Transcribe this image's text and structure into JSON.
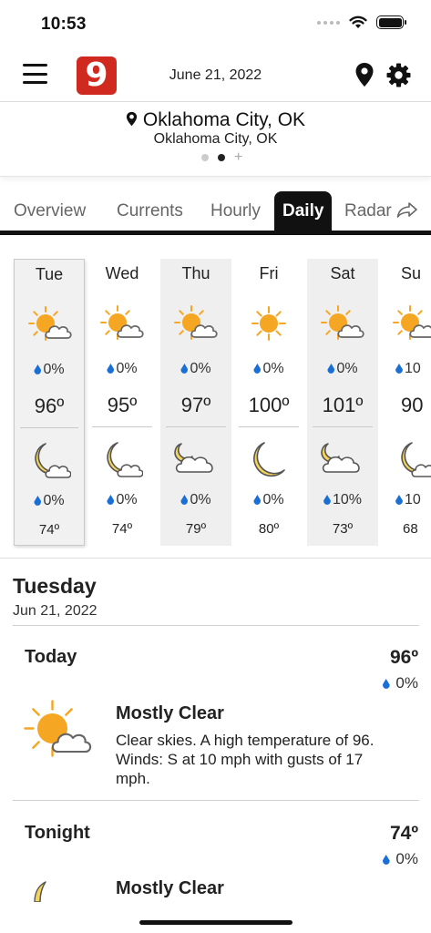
{
  "status_bar": {
    "time": "10:53"
  },
  "header": {
    "logo_text": "9",
    "date": "June 21, 2022"
  },
  "location": {
    "primary": "Oklahoma City, OK",
    "secondary": "Oklahoma City, OK"
  },
  "tabs": [
    {
      "label": "Overview",
      "active": false
    },
    {
      "label": "Currents",
      "active": false
    },
    {
      "label": "Hourly",
      "active": false
    },
    {
      "label": "Daily",
      "active": true
    },
    {
      "label": "Radar",
      "active": false
    }
  ],
  "daily": [
    {
      "day": "Tue",
      "day_icon": "partly-sunny-icon",
      "day_precip": "0%",
      "high": "96º",
      "night_icon": "moon-cloud-icon",
      "night_precip": "0%",
      "low": "74º"
    },
    {
      "day": "Wed",
      "day_icon": "partly-sunny-icon",
      "day_precip": "0%",
      "high": "95º",
      "night_icon": "moon-cloud-icon",
      "night_precip": "0%",
      "low": "74º"
    },
    {
      "day": "Thu",
      "day_icon": "partly-sunny-icon",
      "day_precip": "0%",
      "high": "97º",
      "night_icon": "cloud-moon-icon",
      "night_precip": "0%",
      "low": "79º"
    },
    {
      "day": "Fri",
      "day_icon": "sun-icon",
      "day_precip": "0%",
      "high": "100º",
      "night_icon": "moon-icon",
      "night_precip": "0%",
      "low": "80º"
    },
    {
      "day": "Sat",
      "day_icon": "partly-sunny-icon",
      "day_precip": "0%",
      "high": "101º",
      "night_icon": "cloud-moon-icon",
      "night_precip": "10%",
      "low": "73º"
    },
    {
      "day": "Su",
      "day_icon": "partly-sunny-icon",
      "day_precip": "10",
      "high": "90",
      "night_icon": "moon-cloud-icon",
      "night_precip": "10",
      "low": "68"
    }
  ],
  "detail": {
    "title": "Tuesday",
    "date": "Jun 21, 2022",
    "periods": [
      {
        "name": "Today",
        "temp": "96º",
        "precip": "0%",
        "condition": "Mostly Clear",
        "description": "Clear skies.  A high temperature of 96.  Winds: S at 10 mph with gusts of 17 mph."
      },
      {
        "name": "Tonight",
        "temp": "74º",
        "precip": "0%",
        "condition": "Mostly Clear",
        "description": ""
      }
    ]
  },
  "colors": {
    "sun": "#f5a623",
    "precip_drop": "#1a6fd6",
    "logo": "#d02a20",
    "moon": "#f3d35a"
  }
}
